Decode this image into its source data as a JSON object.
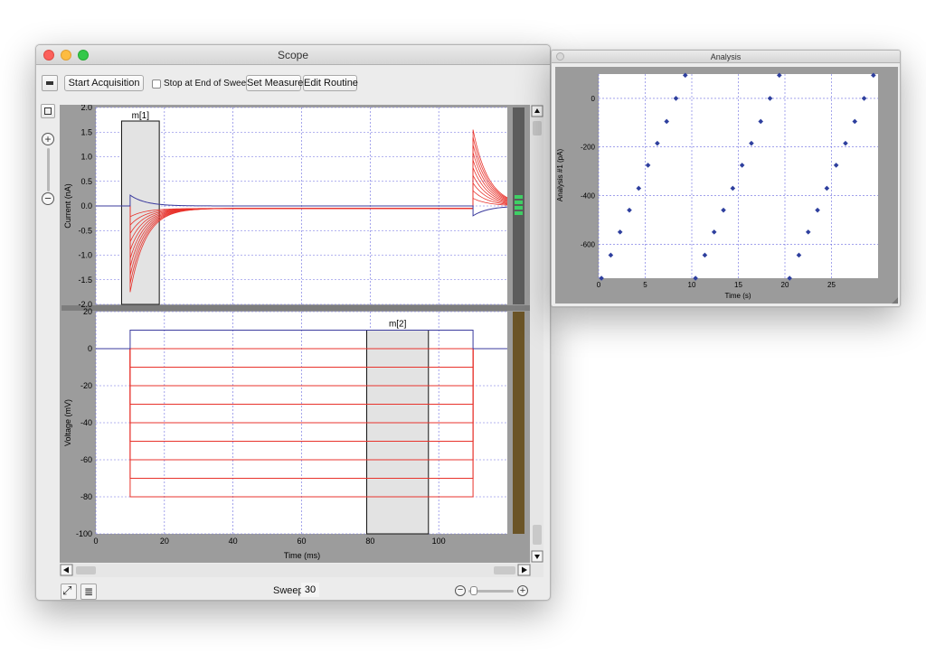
{
  "scope": {
    "title": "Scope",
    "toolbar": {
      "start_label": "Start Acquisition",
      "stop_label": "Stop at End of Sweep",
      "stop_checked": false,
      "set_measure_label": "Set Measure",
      "edit_routine_label": "Edit Routine"
    },
    "sweep_label": "Sweep",
    "sweep_value": "30",
    "top_plot": {
      "ylabel": "Current (nA)",
      "yticks": [
        "2.0",
        "1.5",
        "1.0",
        "0.5",
        "0.0",
        "-0.5",
        "-1.0",
        "-1.5",
        "-2.0"
      ],
      "ylim": [
        -2.0,
        2.0
      ],
      "marker_label": "m[1]",
      "marker_range_ms": [
        7.5,
        18.5
      ],
      "trace_color": "#e8332c",
      "baseline_color": "#3b3b9e"
    },
    "bottom_plot": {
      "ylabel": "Voltage (mV)",
      "xlabel": "Time (ms)",
      "yticks": [
        "20",
        "0",
        "-20",
        "-40",
        "-60",
        "-80",
        "-100"
      ],
      "xticks": [
        "0",
        "20",
        "40",
        "60",
        "80",
        "100"
      ],
      "ylim": [
        -100,
        20
      ],
      "xlim": [
        0,
        120
      ],
      "marker_label": "m[2]",
      "marker_range_ms": [
        79,
        97
      ],
      "step_levels_mv": [
        0,
        -10,
        -20,
        -30,
        -40,
        -50,
        -60,
        -70,
        -80
      ],
      "holding_mv": 0,
      "step_on_ms": 10,
      "step_off_ms": 110
    }
  },
  "analysis": {
    "title": "Analysis",
    "chart_data": {
      "type": "scatter",
      "xlabel": "Time (s)",
      "ylabel": "Analysis #1 (pA)",
      "xticks": [
        "0",
        "5",
        "10",
        "15",
        "20",
        "25"
      ],
      "yticks": [
        "0",
        "-200",
        "-400",
        "-600"
      ],
      "xlim": [
        0,
        30
      ],
      "ylim": [
        -740,
        100
      ],
      "grid": true,
      "marker_color": "#2e3f9e",
      "points": [
        {
          "x": 0.3,
          "y": -740
        },
        {
          "x": 1.3,
          "y": -645
        },
        {
          "x": 2.3,
          "y": -550
        },
        {
          "x": 3.3,
          "y": -460
        },
        {
          "x": 4.3,
          "y": -370
        },
        {
          "x": 5.3,
          "y": -275
        },
        {
          "x": 6.3,
          "y": -185
        },
        {
          "x": 7.3,
          "y": -95
        },
        {
          "x": 8.3,
          "y": 0
        },
        {
          "x": 9.3,
          "y": 95
        },
        {
          "x": 10.4,
          "y": -740
        },
        {
          "x": 11.4,
          "y": -645
        },
        {
          "x": 12.4,
          "y": -550
        },
        {
          "x": 13.4,
          "y": -460
        },
        {
          "x": 14.4,
          "y": -370
        },
        {
          "x": 15.4,
          "y": -275
        },
        {
          "x": 16.4,
          "y": -185
        },
        {
          "x": 17.4,
          "y": -95
        },
        {
          "x": 18.4,
          "y": 0
        },
        {
          "x": 19.4,
          "y": 95
        },
        {
          "x": 20.5,
          "y": -740
        },
        {
          "x": 21.5,
          "y": -645
        },
        {
          "x": 22.5,
          "y": -550
        },
        {
          "x": 23.5,
          "y": -460
        },
        {
          "x": 24.5,
          "y": -370
        },
        {
          "x": 25.5,
          "y": -275
        },
        {
          "x": 26.5,
          "y": -185
        },
        {
          "x": 27.5,
          "y": -95
        },
        {
          "x": 28.5,
          "y": 0
        },
        {
          "x": 29.5,
          "y": 95
        }
      ]
    }
  },
  "icons": {
    "record": "record-icon",
    "toolbox": "toolbox-icon",
    "zoom_in": "zoom-in-icon",
    "zoom_out": "zoom-out-icon",
    "fit": "fit-window-icon",
    "list": "list-icon"
  }
}
